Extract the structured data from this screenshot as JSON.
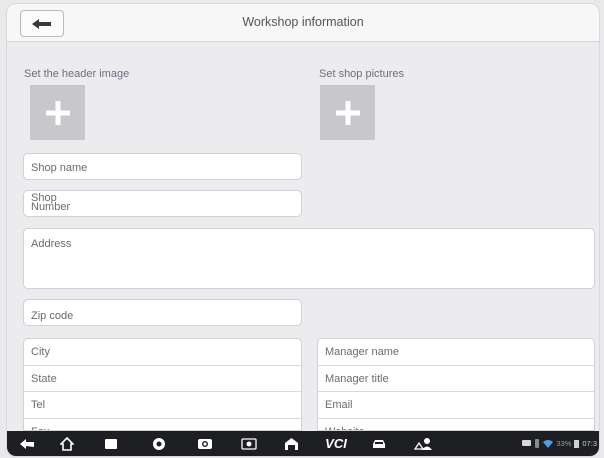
{
  "header": {
    "title": "Workshop information"
  },
  "images": {
    "header_label": "Set the header image",
    "shop_label": "Set shop pictures"
  },
  "fields": {
    "shop_name": "Shop name",
    "shop_number": "Shop\nNumber",
    "address": "Address",
    "zip_code": "Zip code"
  },
  "left_group": [
    "City",
    "State",
    "Tel",
    "Fax"
  ],
  "right_group": [
    "Manager name",
    "Manager title",
    "Email",
    "Website"
  ],
  "status_bar": {
    "battery": "33%",
    "time": "07:3"
  },
  "colors": {
    "accent_label": "#6a6f80",
    "nav_bg": "#1e1f22",
    "add_box": "#c7c7cc"
  }
}
